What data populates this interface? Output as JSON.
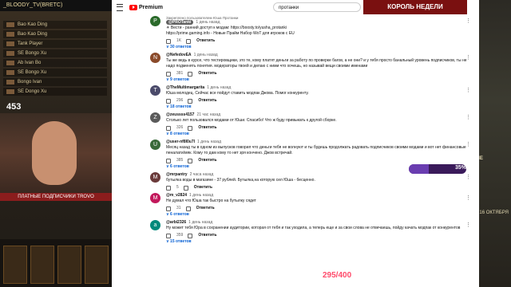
{
  "stream": {
    "channel_name": "_BLOODY_TV(BRETC)",
    "player_rows": [
      "Bao Kao Ding",
      "Bao Kao Ding",
      "Tank Player",
      "SE Bongo Xu",
      "Ab Ivan Bo",
      "SE Bongo Xu",
      "Bongo Ivan",
      "SE Dongo Xu"
    ],
    "score": "453",
    "cam_bar": "ПЛАТНЫЕ ПОДПИСЧИКИ TROVO",
    "king_banner": "КОРОЛЬ НЕДЕЛИ",
    "progress_percent": 35,
    "progress_label": "35%",
    "hp_label": "295/400",
    "right_label": "ОВЫЕ",
    "right_date": "ДО 16 ОКТЯБРЯ"
  },
  "youtube": {
    "brand": "Premium",
    "search_value": "протанки",
    "comments": [
      {
        "pinned": "Закреплено пользователем Юша Протанки",
        "author": "@PROTanki",
        "author_style": "pill",
        "date": "1 день назад",
        "text": "☀ Вести - ранний доступ к модам: https://boosty.to/yusha_protanki",
        "text2": "https://prime.gaming.info - Новые Прайм Набор WoT для игроков с EU",
        "likes": "1K",
        "replies": "∨ 30 ответов",
        "avatar": "P",
        "avatar_color": "#2a6a2a"
      },
      {
        "author": "@NefedovEA",
        "date": "1 день назад",
        "text": "Ты же ведь в курсе, что тестировщики, это те, кому платят деньги за работу по проверке багов, а не они? и у тебя просто банальный уровень подписчиков, ты не надо подменять понятия. модераторы твоей и делаю с ними что хочешь, но называй вещи своими именами",
        "likes": "381",
        "replies": "∨ 9 ответов",
        "avatar": "N",
        "avatar_color": "#8a4a2a"
      },
      {
        "author": "@TheMultimargarita",
        "date": "1 день назад",
        "text": "Юша молодец. Сейчас все пойдут ставить модпак Джова. Помог конкуренту.",
        "likes": "296",
        "replies": "∨ 18 ответов",
        "avatar": "T",
        "avatar_color": "#4a4a6a"
      },
      {
        "author": "@zeussss4157",
        "date": "21 час назад",
        "text": "Столько лет пользовался модами от Юши. Спасибо! Что ж буду привыкать к другой сборке.",
        "likes": "326",
        "replies": "∨ 8 ответов",
        "avatar": "Z",
        "avatar_color": "#5a5a5a"
      },
      {
        "author": "@user-nf8l0u7l",
        "date": "1 день назад",
        "text": "Месяц назад ты в одном из выпусков говорил что деньги тебя не волнуют и ты будешь продолжать радовать подписчиков своими модами и вот нет финансовые пеналати/мяк. Кому то дам кому то нет зря кончено. Джов встречай.",
        "likes": "385",
        "replies": "∨ 6 ответов",
        "avatar": "U",
        "avatar_color": "#3a6a3a"
      },
      {
        "author": "@mrpantry",
        "date": "2 часа назад",
        "text": "бутылка воды в магазине - 37 рублей. Бутылка,на которую сел Юша - бесценно.",
        "likes": "5",
        "replies": "",
        "avatar": "M",
        "avatar_color": "#6a3a3a"
      },
      {
        "author": "@m_v2824",
        "date": "1 день назад",
        "text": "Не думал что Юша так быстро на бутылку сядет",
        "likes": "31",
        "replies": "∨ 6 ответов",
        "avatar": "M",
        "avatar_color": "#c2185b"
      },
      {
        "author": "@arbi2326",
        "date": "1 день назад",
        "text": "Ну может тебя Юра в сохранении аудитории, которая от тебя и так уходила, а теперь еще и за свои слова не отвечаешь, пойду качать модпак от конкурентов",
        "likes": "359",
        "replies": "∨ 15 ответов",
        "avatar": "a",
        "avatar_color": "#00897b"
      }
    ],
    "labels": {
      "reply": "Ответить"
    }
  }
}
